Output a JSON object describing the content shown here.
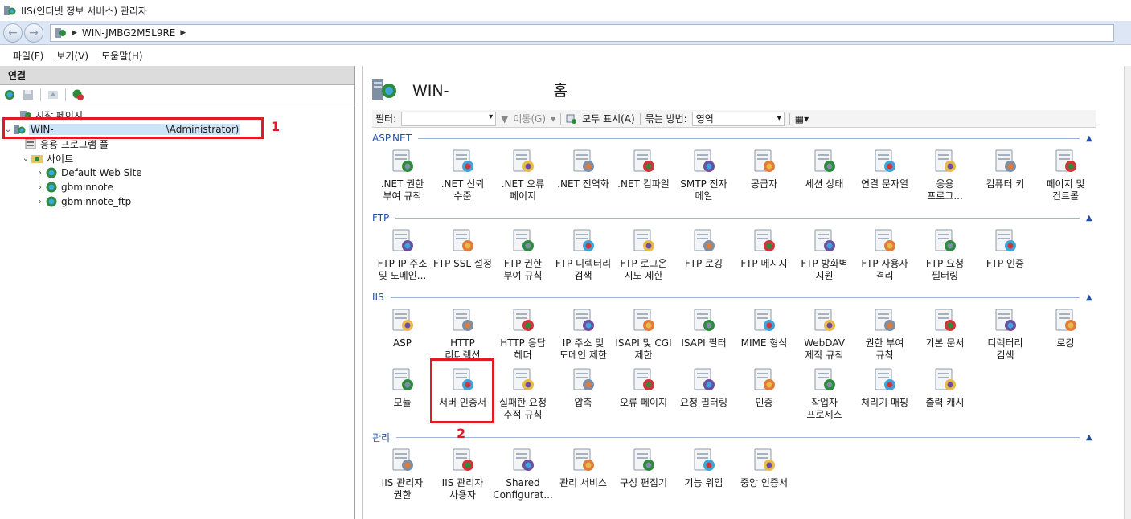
{
  "window": {
    "title": "IIS(인터넷 정보 서비스) 관리자"
  },
  "address": {
    "path": "WIN-JMBG2M5L9RE"
  },
  "menu": [
    "파일(F)",
    "보기(V)",
    "도움말(H)"
  ],
  "connections": {
    "header": "연결",
    "tree": [
      {
        "label": "시작 페이지"
      },
      {
        "label": "WIN-",
        "suffix": "\\Administrator)",
        "selected": true
      },
      {
        "label": "응용 프로그램 풀"
      },
      {
        "label": "사이트"
      },
      {
        "label": "Default Web Site"
      },
      {
        "label": "gbminnote"
      },
      {
        "label": "gbminnote_ftp"
      }
    ]
  },
  "home": {
    "title": "WIN-",
    "title_suffix": "홈"
  },
  "filter": {
    "label": "필터:",
    "go": "이동(G)",
    "show_all": "모두 표시(A)",
    "group_by": "묶는 방법:",
    "group_value": "영역"
  },
  "annotations": {
    "box1": "1",
    "box2": "2"
  },
  "sections": [
    {
      "name": "ASP.NET",
      "items": [
        {
          "label": ".NET 권한\n부여 규칙",
          "icon": "lock-doc-icon"
        },
        {
          "label": ".NET 신뢰\n수준",
          "icon": "globe-check-icon"
        },
        {
          "label": ".NET 오류\n페이지",
          "icon": "warning-404-icon"
        },
        {
          "label": ".NET 전역화",
          "icon": "globe-icon"
        },
        {
          "label": ".NET 컴파일",
          "icon": "compile-icon"
        },
        {
          "label": "SMTP 전자\n메일",
          "icon": "mail-icon"
        },
        {
          "label": "공급자",
          "icon": "providers-icon"
        },
        {
          "label": "세션 상태",
          "icon": "session-icon"
        },
        {
          "label": "연결 문자열",
          "icon": "db-ab-icon"
        },
        {
          "label": "응용\n프로그...",
          "icon": "settings-list-icon"
        },
        {
          "label": "컴퓨터 키",
          "icon": "machine-key-icon"
        },
        {
          "label": "페이지 및\n컨트롤",
          "icon": "page-controls-icon"
        }
      ]
    },
    {
      "name": "FTP",
      "items": [
        {
          "label": "FTP IP 주소\n및 도메인...",
          "icon": "ftp-ip-icon"
        },
        {
          "label": "FTP SSL 설정",
          "icon": "ftp-lock-icon"
        },
        {
          "label": "FTP 권한\n부여 규칙",
          "icon": "ftp-key-icon"
        },
        {
          "label": "FTP 디렉터리\n검색",
          "icon": "ftp-browse-icon"
        },
        {
          "label": "FTP 로그온\n시도 제한",
          "icon": "ftp-globe-icon"
        },
        {
          "label": "FTP 로깅",
          "icon": "ftp-log-icon"
        },
        {
          "label": "FTP 메시지",
          "icon": "ftp-message-icon"
        },
        {
          "label": "FTP 방화벽\n지원",
          "icon": "ftp-firewall-icon"
        },
        {
          "label": "FTP 사용자\n격리",
          "icon": "ftp-users-icon"
        },
        {
          "label": "FTP 요청\n필터링",
          "icon": "ftp-filter-icon"
        },
        {
          "label": "FTP 인증",
          "icon": "ftp-auth-icon"
        }
      ]
    },
    {
      "name": "IIS",
      "items": [
        {
          "label": "ASP",
          "icon": "asp-icon"
        },
        {
          "label": "HTTP\n리디렉션",
          "icon": "redirect-icon"
        },
        {
          "label": "HTTP 응답\n헤더",
          "icon": "headers-icon"
        },
        {
          "label": "IP 주소 및\n도메인 제한",
          "icon": "ip-restrict-icon"
        },
        {
          "label": "ISAPI 및 CGI\n제한",
          "icon": "isapi-cgi-icon"
        },
        {
          "label": "ISAPI 필터",
          "icon": "isapi-filter-icon"
        },
        {
          "label": "MIME 형식",
          "icon": "mime-icon"
        },
        {
          "label": "WebDAV\n제작 규칙",
          "icon": "webdav-icon"
        },
        {
          "label": "권한 부여\n규칙",
          "icon": "authz-icon"
        },
        {
          "label": "기본 문서",
          "icon": "default-doc-icon"
        },
        {
          "label": "디렉터리\n검색",
          "icon": "dir-browse-icon"
        },
        {
          "label": "로깅",
          "icon": "logging-icon"
        },
        {
          "label": "모듈",
          "icon": "modules-icon"
        },
        {
          "label": "서버 인증서",
          "icon": "certificate-icon"
        },
        {
          "label": "실패한 요청\n추적 규칙",
          "icon": "failed-req-icon"
        },
        {
          "label": "압축",
          "icon": "compression-icon"
        },
        {
          "label": "오류 페이지",
          "icon": "error-pages-icon"
        },
        {
          "label": "요청 필터링",
          "icon": "req-filter-icon"
        },
        {
          "label": "인증",
          "icon": "auth-icon"
        },
        {
          "label": "작업자\n프로세스",
          "icon": "worker-process-icon"
        },
        {
          "label": "처리기 매핑",
          "icon": "handler-mapping-icon"
        },
        {
          "label": "출력 캐시",
          "icon": "output-cache-icon"
        }
      ]
    },
    {
      "name": "관리",
      "items": [
        {
          "label": "IIS 관리자\n권한",
          "icon": "mgr-perm-icon"
        },
        {
          "label": "IIS 관리자\n사용자",
          "icon": "mgr-users-icon"
        },
        {
          "label": "Shared\nConfigurat...",
          "icon": "shared-config-icon"
        },
        {
          "label": "관리 서비스",
          "icon": "mgmt-service-icon"
        },
        {
          "label": "구성 편집기",
          "icon": "config-editor-icon"
        },
        {
          "label": "기능 위임",
          "icon": "delegation-icon"
        },
        {
          "label": "중앙 인증서",
          "icon": "central-cert-icon"
        }
      ]
    }
  ],
  "colors": {
    "highlight": "#e01b24",
    "section": "#1f4fa0",
    "selected": "#cce4f7"
  }
}
